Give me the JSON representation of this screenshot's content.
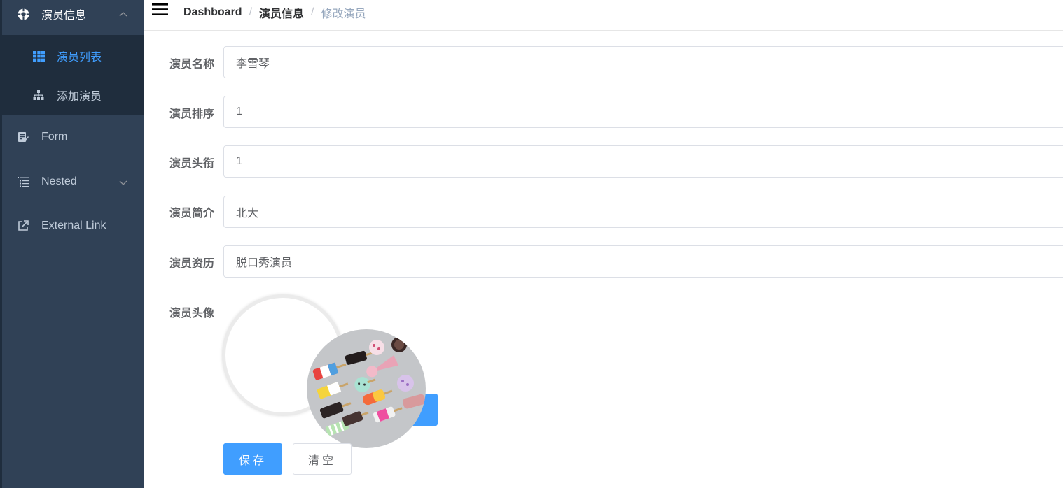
{
  "sidebar": {
    "group": {
      "label": "演员信息",
      "icon": "target-icon",
      "expanded": true
    },
    "sub_items": [
      {
        "label": "演员列表",
        "icon": "table-icon",
        "active": true
      },
      {
        "label": "添加演员",
        "icon": "tree-icon",
        "active": false
      }
    ],
    "items": [
      {
        "label": "Form",
        "icon": "form-icon"
      },
      {
        "label": "Nested",
        "icon": "nested-icon"
      },
      {
        "label": "External Link",
        "icon": "external-link-icon"
      }
    ]
  },
  "breadcrumb": {
    "items": [
      "Dashboard",
      "演员信息"
    ],
    "separator": "/",
    "current": "修改演员"
  },
  "form": {
    "fields": [
      {
        "label": "演员名称",
        "value": "李雪琴"
      },
      {
        "label": "演员排序",
        "value": "1"
      },
      {
        "label": "演员头衔",
        "value": "1"
      },
      {
        "label": "演员简介",
        "value": "北大"
      },
      {
        "label": "演员资历",
        "value": "脱口秀演员"
      }
    ],
    "avatar_label": "演员头像",
    "save_label": "保存",
    "clear_label": "清空"
  },
  "colors": {
    "sidebar_bg": "#304156",
    "submenu_bg": "#1f2d3d",
    "active": "#409eff",
    "menu_text": "#bfcbd9"
  }
}
